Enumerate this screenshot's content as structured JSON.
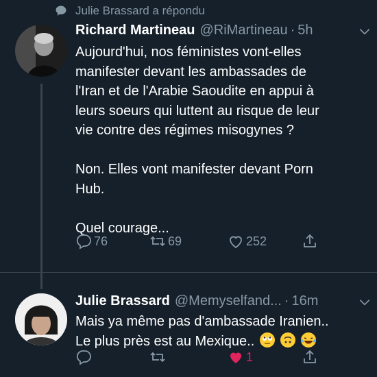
{
  "reply_context": {
    "icon": "speech-bubble-icon",
    "text": "Julie Brassard a répondu"
  },
  "tweets": [
    {
      "author_name": "Richard Martineau",
      "handle": "@RiMartineau",
      "separator": "·",
      "time": "5h",
      "text": "Aujourd'hui, nos féministes vont-elles\nmanifester devant les ambassades de\nl'Iran et de l'Arabie Saoudite en appui à\nleurs soeurs qui luttent au risque de leur\nvie contre des régimes misogynes ?\n\nNon. Elles vont manifester devant Porn\nHub.\n\nQuel courage...",
      "replies": "76",
      "retweets": "69",
      "likes": "252"
    },
    {
      "author_name": "Julie Brassard",
      "handle": "@Memyselfand...",
      "separator": "·",
      "time": "16m",
      "text": "Mais ya même pas d'ambassade Iranien..\nLe plus près est au Mexique..",
      "emojis": [
        "eye-roll-emoji",
        "upside-down-face-emoji",
        "tears-of-joy-emoji"
      ],
      "replies": "",
      "retweets": "",
      "likes": "1"
    }
  ],
  "colors": {
    "background": "#15202b",
    "secondary_text": "#8899a6",
    "like_active": "#e0245e",
    "divider": "#38444d"
  }
}
